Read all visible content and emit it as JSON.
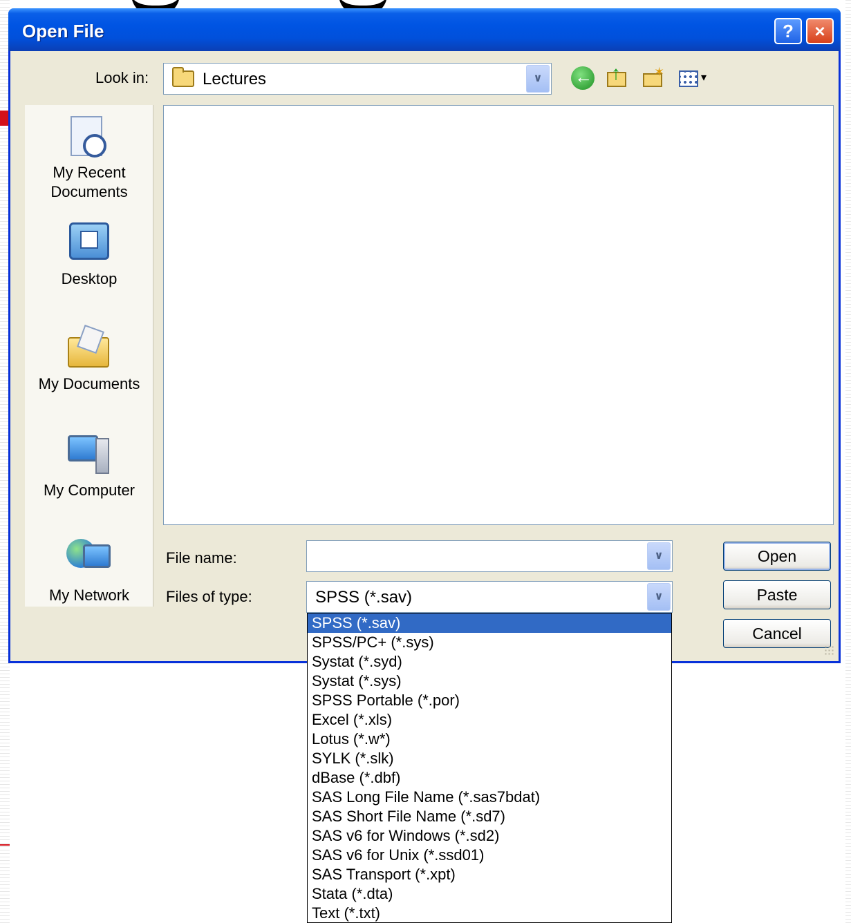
{
  "window": {
    "title": "Open File"
  },
  "title_buttons": {
    "help": "?",
    "close": "×"
  },
  "look_in": {
    "label": "Look in:",
    "value": "Lectures"
  },
  "toolbar": {
    "icons": [
      "back-icon",
      "up-folder-icon",
      "new-folder-icon",
      "views-menu-icon"
    ]
  },
  "places": [
    {
      "line1": "My Recent",
      "line2": "Documents",
      "icon": "recent-documents-icon"
    },
    {
      "line1": "Desktop",
      "line2": "",
      "icon": "desktop-icon"
    },
    {
      "line1": "My Documents",
      "line2": "",
      "icon": "my-documents-icon"
    },
    {
      "line1": "My Computer",
      "line2": "",
      "icon": "my-computer-icon"
    },
    {
      "line1": "My Network",
      "line2": "",
      "icon": "my-network-icon"
    }
  ],
  "file_name": {
    "label": "File name:",
    "value": ""
  },
  "file_type": {
    "label": "Files of type:",
    "value": "SPSS (*.sav)",
    "options": [
      "SPSS (*.sav)",
      "SPSS/PC+ (*.sys)",
      "Systat (*.syd)",
      "Systat (*.sys)",
      "SPSS Portable (*.por)",
      "Excel (*.xls)",
      "Lotus (*.w*)",
      "SYLK (*.slk)",
      "dBase (*.dbf)",
      "SAS Long File Name (*.sas7bdat)",
      "SAS Short File Name (*.sd7)",
      "SAS v6 for Windows (*.sd2)",
      "SAS v6 for Unix (*.ssd01)",
      "SAS Transport (*.xpt)",
      "Stata (*.dta)",
      "Text (*.txt)"
    ],
    "selected_index": 0
  },
  "buttons": {
    "open": "Open",
    "paste": "Paste",
    "cancel": "Cancel"
  },
  "colors": {
    "titlebar": "#0054e3",
    "selection": "#316ac5",
    "dialog_bg": "#ece9d8"
  }
}
